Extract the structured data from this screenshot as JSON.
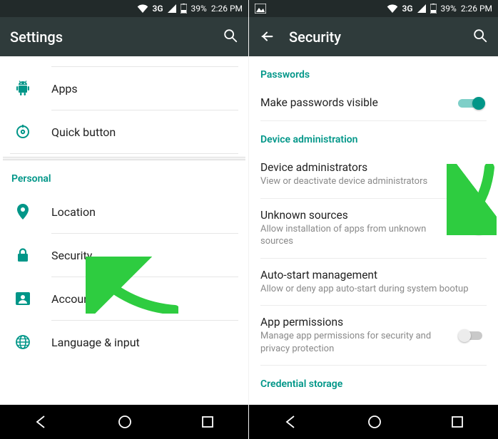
{
  "status": {
    "network": "3G",
    "battery": "39%",
    "time": "2:26 PM"
  },
  "left": {
    "title": "Settings",
    "items": {
      "apps": "Apps",
      "quick_button": "Quick button"
    },
    "section_personal": "Personal",
    "personal_items": {
      "location": "Location",
      "security": "Security",
      "accounts": "Accounts",
      "language": "Language & input"
    }
  },
  "right": {
    "title": "Security",
    "section_passwords": "Passwords",
    "make_passwords_visible": "Make passwords visible",
    "section_device_admin": "Device administration",
    "device_admins_title": "Device administrators",
    "device_admins_sub": "View or deactivate device administrators",
    "unknown_sources_title": "Unknown sources",
    "unknown_sources_sub": "Allow installation of apps from unknown sources",
    "autostart_title": "Auto-start management",
    "autostart_sub": "Allow or deny app auto-start during system bootup",
    "app_perm_title": "App permissions",
    "app_perm_sub": "Manage app permissions for security and privacy protection",
    "section_credential": "Credential storage"
  },
  "colors": {
    "teal": "#009688",
    "arrow": "#2ecc40"
  }
}
